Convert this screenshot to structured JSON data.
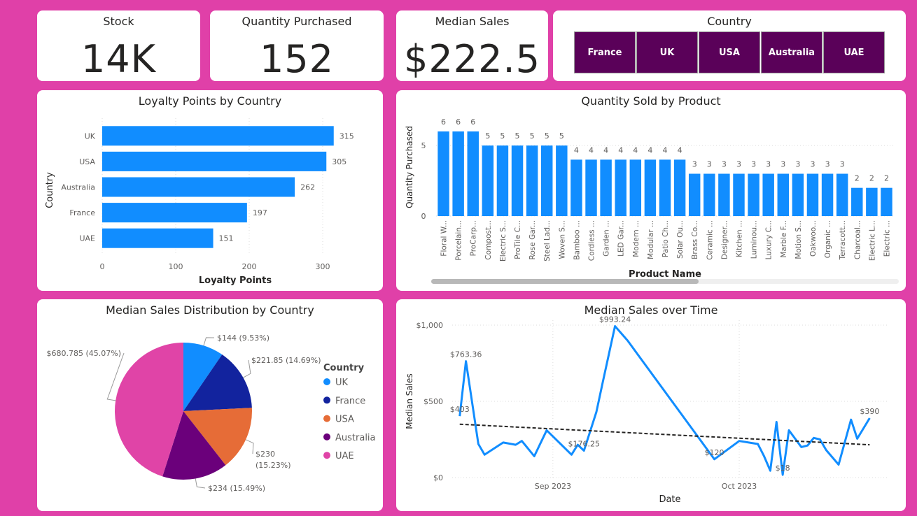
{
  "kpis": {
    "stock": {
      "title": "Stock",
      "value": "14K"
    },
    "quantity": {
      "title": "Quantity Purchased",
      "value": "152"
    },
    "median": {
      "title": "Median Sales",
      "value": "$222.5"
    }
  },
  "slicer": {
    "title": "Country",
    "options": [
      "France",
      "UK",
      "USA",
      "Australia",
      "UAE"
    ]
  },
  "colors": {
    "background": "#e040a8",
    "bar": "#118dff",
    "slicer": "#5a0159"
  },
  "chart_data": [
    {
      "id": "loyalty",
      "type": "bar",
      "orientation": "horizontal",
      "title": "Loyalty Points by Country",
      "xlabel": "Loyalty Points",
      "ylabel": "Country",
      "categories": [
        "UK",
        "USA",
        "Australia",
        "France",
        "UAE"
      ],
      "values": [
        315,
        305,
        262,
        197,
        151
      ],
      "xlim": [
        0,
        320
      ],
      "xticks": [
        "0",
        "100",
        "200",
        "300"
      ],
      "grid": true
    },
    {
      "id": "qty",
      "type": "bar",
      "title": "Quantity Sold by Product",
      "xlabel": "Product Name",
      "ylabel": "Quantity Purchased",
      "categories": [
        "Floral W...",
        "Porcelain...",
        "ProCarp...",
        "Compost...",
        "Electric S...",
        "ProTile C...",
        "Rose Gar...",
        "Steel Lad...",
        "Woven S...",
        "Bamboo ...",
        "Cordless ...",
        "Garden ...",
        "LED Gar...",
        "Modern ...",
        "Modular ...",
        "Patio Ch...",
        "Solar Ou...",
        "Brass Co...",
        "Ceramic ...",
        "Designer...",
        "Kitchen ...",
        "Luminou...",
        "Luxury C...",
        "Marble F...",
        "Motion S...",
        "Oakwoo...",
        "Organic ...",
        "Terracott...",
        "Charcoal...",
        "Electric L...",
        "Electric ..."
      ],
      "values": [
        6,
        6,
        6,
        5,
        5,
        5,
        5,
        5,
        5,
        4,
        4,
        4,
        4,
        4,
        4,
        4,
        4,
        3,
        3,
        3,
        3,
        3,
        3,
        3,
        3,
        3,
        3,
        3,
        2,
        2,
        2
      ],
      "ylim": [
        0,
        6
      ],
      "yticks": [
        "0",
        "5"
      ],
      "grid": true
    },
    {
      "id": "pie",
      "type": "pie",
      "title": "Median Sales Distribution by Country",
      "legend_title": "Country",
      "legend_position": "right",
      "slices": [
        {
          "name": "UK",
          "value": 144,
          "label": "$144 (9.53%)",
          "color": "#118dff"
        },
        {
          "name": "France",
          "value": 221.85,
          "label": "$221.85 (14.69%)",
          "color": "#12239e"
        },
        {
          "name": "USA",
          "value": 230,
          "label_line1": "$230",
          "label_line2": "(15.23%)",
          "color": "#e66c37"
        },
        {
          "name": "Australia",
          "value": 234,
          "label": "$234 (15.49%)",
          "color": "#6b007b"
        },
        {
          "name": "UAE",
          "value": 680.785,
          "label": "$680.785 (45.07%)",
          "color": "#e044a7"
        }
      ]
    },
    {
      "id": "line",
      "type": "line",
      "title": "Median Sales over Time",
      "xlabel": "Date",
      "ylabel": "Median Sales",
      "ylim": [
        0,
        1000
      ],
      "yticks": [
        "$0",
        "$500",
        "$1,000"
      ],
      "xticks": [
        "Sep 2023",
        "Oct 2023"
      ],
      "x": [
        "2023-08-17",
        "2023-08-18",
        "2023-08-20",
        "2023-08-21",
        "2023-08-24",
        "2023-08-26",
        "2023-08-27",
        "2023-08-29",
        "2023-08-31",
        "2023-09-04",
        "2023-09-05",
        "2023-09-06",
        "2023-09-08",
        "2023-09-09",
        "2023-09-11",
        "2023-09-13",
        "2023-09-27",
        "2023-10-01",
        "2023-10-04",
        "2023-10-05",
        "2023-10-06",
        "2023-10-07",
        "2023-10-08",
        "2023-10-09",
        "2023-10-11",
        "2023-10-12",
        "2023-10-13",
        "2023-10-14",
        "2023-10-15",
        "2023-10-17",
        "2023-10-19",
        "2023-10-20",
        "2023-10-22",
        "2023-10-23"
      ],
      "values": [
        403,
        763.36,
        220,
        150,
        230,
        215,
        240,
        140,
        310,
        150,
        215,
        176.25,
        430,
        620,
        993.24,
        900,
        120,
        240,
        220,
        140,
        45,
        365,
        18,
        310,
        200,
        210,
        260,
        250,
        180,
        85,
        380,
        255,
        390
      ],
      "data_labels": [
        "$403",
        "$763.36",
        "$176.25",
        "$993.24",
        "$120",
        "$18",
        "$390"
      ],
      "trendline": [
        350,
        215
      ]
    }
  ]
}
